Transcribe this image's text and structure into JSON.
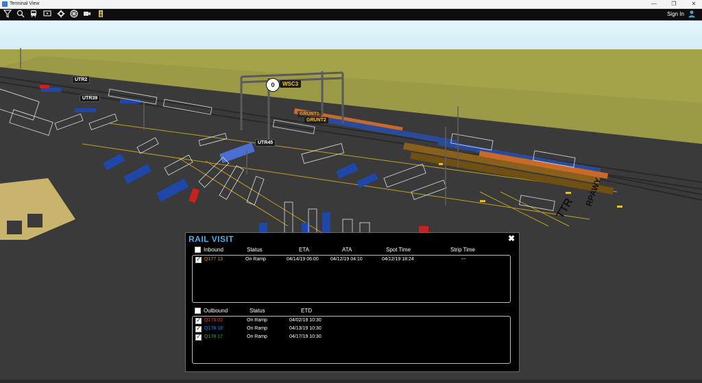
{
  "window": {
    "title": "Terminal View",
    "minimize": "—",
    "restore": "❐",
    "close": "✕"
  },
  "toolbar": {
    "signin_label": "Sign In"
  },
  "map": {
    "labels": [
      "UTR2",
      "UTR39",
      "UTR45",
      "GRUNT2",
      "GRUNT1"
    ],
    "crane_label": "WSC3",
    "crane_count": "0",
    "ground_text_1": "TTR",
    "ground_text_2": "RPAWY"
  },
  "rail_visit": {
    "title": "RAIL VISIT",
    "close": "✖",
    "inbound": {
      "headers": [
        "Inbound",
        "Status",
        "ETA",
        "ATA",
        "Spot Time",
        "Strip Time"
      ],
      "rows": [
        {
          "id": "Q177 13",
          "color": "#f28a1a",
          "status": "On Ramp",
          "eta": "04/14/19 06:00",
          "ata": "04/12/19 04:10",
          "spot": "04/12/19 18:24",
          "strip": "---"
        }
      ]
    },
    "outbound": {
      "headers": [
        "Outbound",
        "Status",
        "ETD"
      ],
      "rows": [
        {
          "id": "Q178 02",
          "color": "#e53935",
          "status": "On Ramp",
          "etd": "04/02/19 10:30"
        },
        {
          "id": "Q178 18",
          "color": "#1e88e5",
          "status": "On Ramp",
          "etd": "04/13/19 10:30"
        },
        {
          "id": "Q178 17",
          "color": "#43a047",
          "status": "On Ramp",
          "etd": "04/17/19 10:30"
        }
      ]
    }
  }
}
